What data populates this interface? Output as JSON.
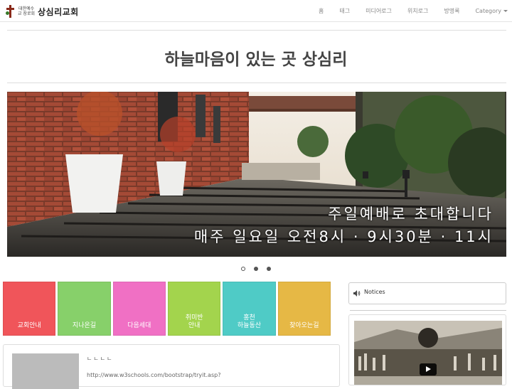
{
  "navbar": {
    "brand_sub": "대한예수교 장로회",
    "brand_name": "상심리교회",
    "items": [
      {
        "label": "홈"
      },
      {
        "label": "태그"
      },
      {
        "label": "미디어로그"
      },
      {
        "label": "위치로그"
      },
      {
        "label": "방명록"
      },
      {
        "label": "Category"
      }
    ]
  },
  "header": {
    "title": "하늘마음이 있는 곳 상심리"
  },
  "carousel": {
    "caption_line1": "주일예배로 초대합니다",
    "caption_line2": "매주 일요일 오전8시 · 9시30분 · 11시",
    "slide_count": 3,
    "active_index": 0
  },
  "tiles": [
    {
      "label": "교회안내",
      "color": "#f0555a"
    },
    {
      "label": "지나온길",
      "color": "#87d06a"
    },
    {
      "label": "다음세대",
      "color": "#f070c4"
    },
    {
      "label": "취미반\n안내",
      "color": "#a3d44d"
    },
    {
      "label": "홍천\n하늘동산",
      "color": "#4fcbc6"
    },
    {
      "label": "찾아오는길",
      "color": "#e6b845"
    }
  ],
  "sidebar": {
    "notices_label": "Notices",
    "notices_icon": "speaker-icon"
  },
  "post": {
    "title": "ㄴㄴㄴㄴ",
    "link": "http://www.w3schools.com/bootstrap/tryit.asp?"
  },
  "video": {
    "play_icon": "play-icon"
  }
}
